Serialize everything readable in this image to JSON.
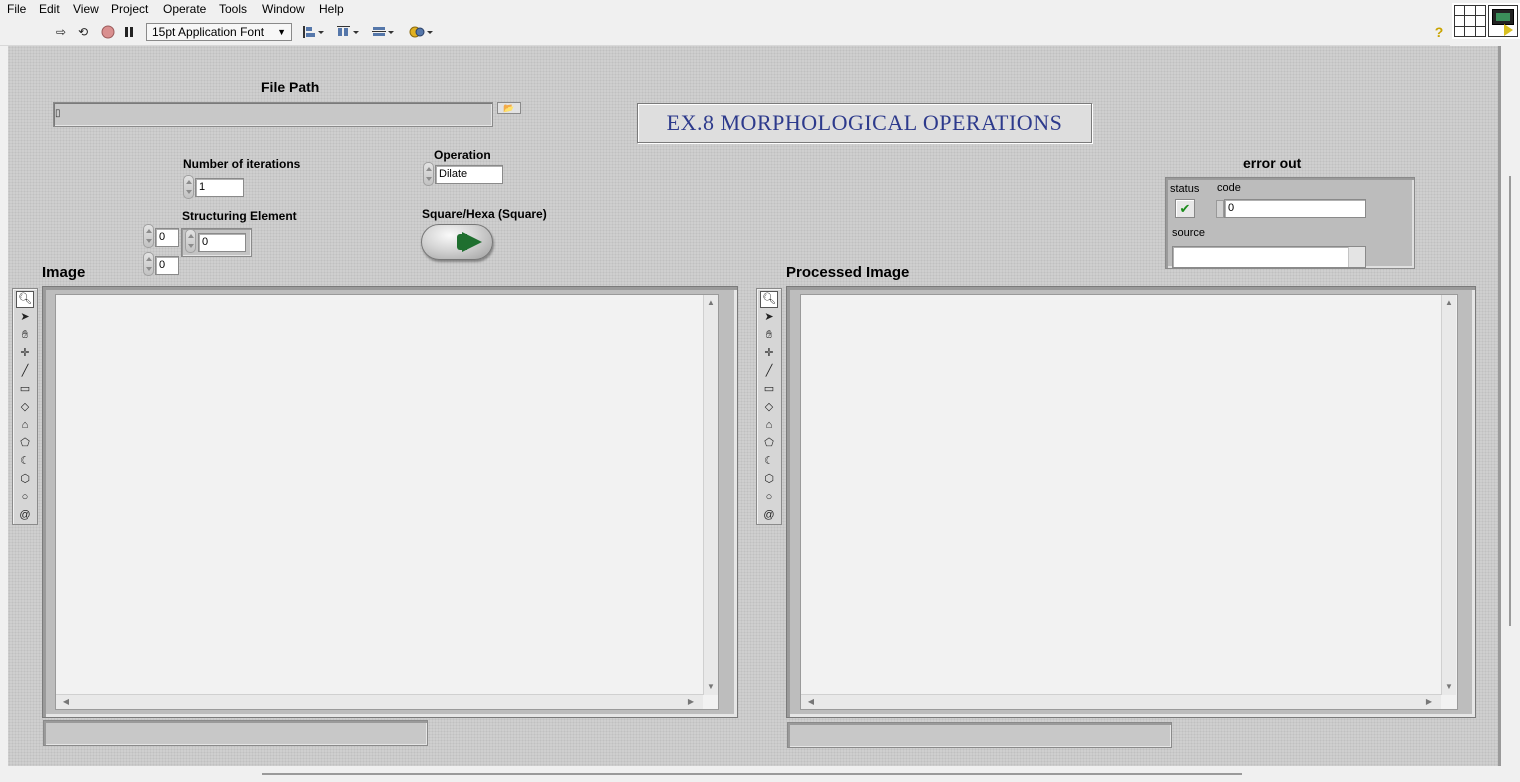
{
  "menubar": {
    "items": [
      "File",
      "Edit",
      "View",
      "Project",
      "Operate",
      "Tools",
      "Window",
      "Help"
    ]
  },
  "toolbar": {
    "font_selector": "15pt Application Font",
    "icons": [
      "run-arrow-icon",
      "run-continuously-icon",
      "abort-icon",
      "pause-icon",
      "align-objects-icon",
      "distribute-objects-icon",
      "resize-objects-icon",
      "reorder-icon",
      "help-icon"
    ]
  },
  "panel": {
    "file_path": {
      "label": "File Path",
      "value": ""
    },
    "title_decoration": "EX.8 MORPHOLOGICAL OPERATIONS",
    "iterations": {
      "label": "Number of iterations",
      "value": "1"
    },
    "operation": {
      "label": "Operation",
      "value": "Dilate"
    },
    "structuring_element": {
      "label": "Structuring Element",
      "row_index": "0",
      "col_index": "0",
      "value": "0"
    },
    "square_hexa": {
      "label": "Square/Hexa (Square)"
    },
    "error_out": {
      "label": "error out",
      "status_label": "status",
      "status_glyph": "✔",
      "code_label": "code",
      "code_value": "0",
      "source_label": "source",
      "source_value": ""
    },
    "image_display": {
      "label": "Image"
    },
    "processed_image_display": {
      "label": "Processed Image"
    },
    "image_tools": [
      "zoom-icon",
      "pointer-icon",
      "pan-icon",
      "point-icon",
      "line-icon",
      "rectangle-icon",
      "rotated-rectangle-icon",
      "polygon-icon",
      "freehand-icon",
      "annulus-icon",
      "oval-icon",
      "broken-line-icon",
      "spiral-icon"
    ]
  },
  "colors": {
    "title_text": "#2d3a8c",
    "panel_background": "#cfcfcf",
    "led_green": "#1f6f2f",
    "status_ok": "#1c8c1c"
  }
}
